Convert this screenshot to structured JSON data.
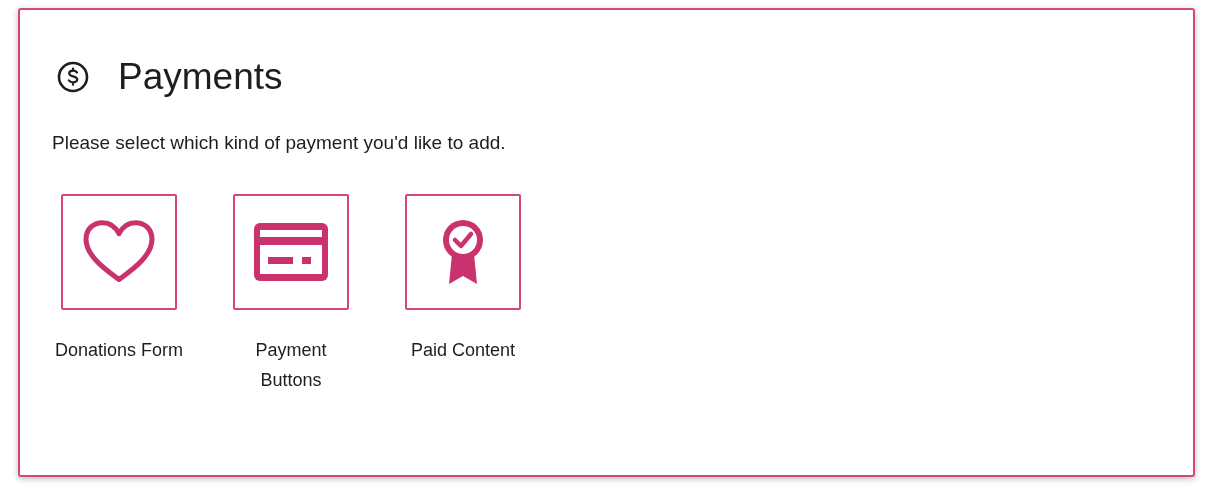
{
  "panel": {
    "title": "Payments",
    "description": "Please select which kind of payment you'd like to add.",
    "options": [
      {
        "kind": "heart",
        "label": "Donations Form"
      },
      {
        "kind": "card",
        "label": "Payment Buttons"
      },
      {
        "kind": "badge",
        "label": "Paid Content"
      }
    ]
  }
}
